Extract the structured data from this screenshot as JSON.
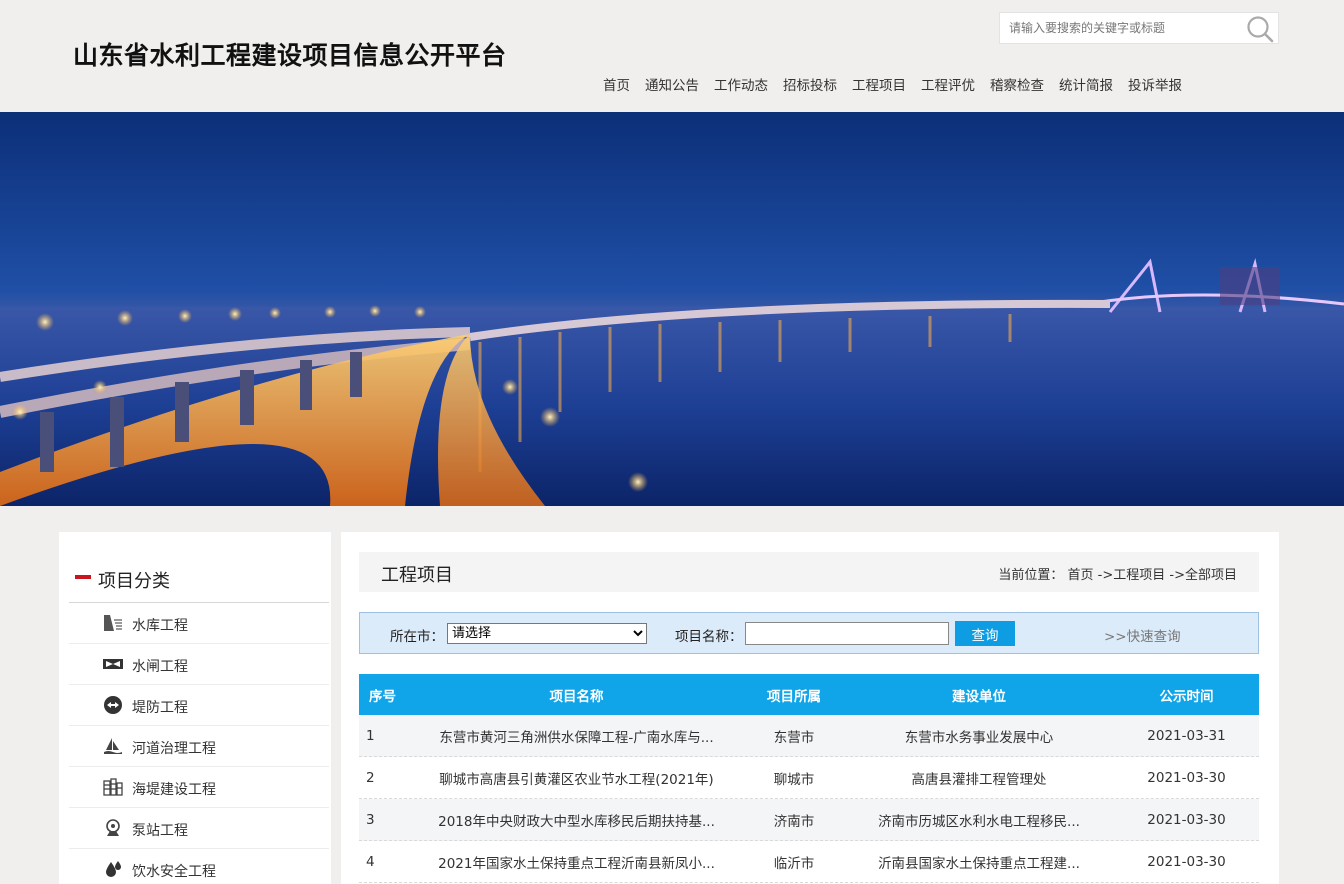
{
  "header": {
    "site_title": "山东省水利工程建设项目信息公开平台",
    "search_placeholder": "请输入要搜索的关键字或标题",
    "nav": [
      "首页",
      "通知公告",
      "工作动态",
      "招标投标",
      "工程项目",
      "工程评优",
      "稽察检查",
      "统计简报",
      "投诉举报"
    ]
  },
  "sidebar": {
    "title": "项目分类",
    "items": [
      {
        "label": "水库工程",
        "icon": "reservoir-icon"
      },
      {
        "label": "水闸工程",
        "icon": "sluice-icon"
      },
      {
        "label": "堤防工程",
        "icon": "embankment-icon"
      },
      {
        "label": "河道治理工程",
        "icon": "river-icon"
      },
      {
        "label": "海堤建设工程",
        "icon": "seawall-icon"
      },
      {
        "label": "泵站工程",
        "icon": "pump-icon"
      },
      {
        "label": "饮水安全工程",
        "icon": "water-drop-icon"
      }
    ]
  },
  "main": {
    "title": "工程项目",
    "breadcrumb": {
      "prefix": "当前位置：",
      "home": "首页",
      "sep1": " ->",
      "section": "工程项目",
      "sep2": " ->",
      "current": "全部项目"
    },
    "filter": {
      "city_label": "所在市：",
      "city_selected": "请选择",
      "name_label": "项目名称：",
      "name_value": "",
      "query_button": "查询",
      "quick_link": ">>快速查询"
    },
    "table": {
      "headers": [
        "序号",
        "项目名称",
        "项目所属",
        "建设单位",
        "公示时间"
      ],
      "rows": [
        [
          "1",
          "东营市黄河三角洲供水保障工程-广南水库与...",
          "东营市",
          "东营市水务事业发展中心",
          "2021-03-31"
        ],
        [
          "2",
          "聊城市高唐县引黄灌区农业节水工程(2021年)",
          "聊城市",
          "高唐县灌排工程管理处",
          "2021-03-30"
        ],
        [
          "3",
          "2018年中央财政大中型水库移民后期扶持基...",
          "济南市",
          "济南市历城区水利水电工程移民...",
          "2021-03-30"
        ],
        [
          "4",
          "2021年国家水土保持重点工程沂南县新凤小...",
          "临沂市",
          "沂南县国家水土保持重点工程建...",
          "2021-03-30"
        ]
      ]
    }
  },
  "colors": {
    "accent_blue": "#10a4e8",
    "button_blue": "#0e9de2",
    "marker_red": "#c9151e",
    "filter_bg": "#dcebf9"
  }
}
